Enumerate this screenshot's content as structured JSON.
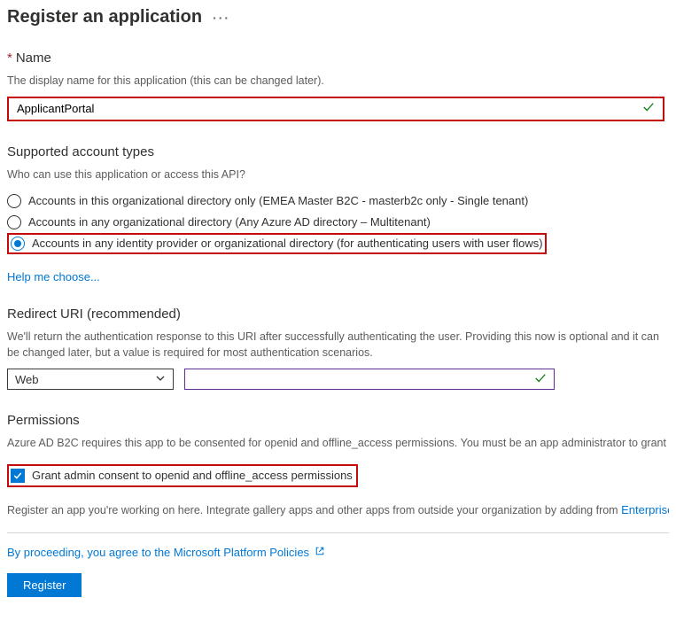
{
  "page": {
    "title": "Register an application",
    "ellipsis": "···"
  },
  "name": {
    "label": "Name",
    "description": "The display name for this application (this can be changed later).",
    "value": "ApplicantPortal"
  },
  "accountTypes": {
    "title": "Supported account types",
    "question": "Who can use this application or access this API?",
    "options": [
      "Accounts in this organizational directory only (EMEA Master B2C - masterb2c only - Single tenant)",
      "Accounts in any organizational directory (Any Azure AD directory – Multitenant)",
      "Accounts in any identity provider or organizational directory (for authenticating users with user flows)"
    ],
    "selectedIndex": 2,
    "helpLink": "Help me choose..."
  },
  "redirect": {
    "title": "Redirect URI (recommended)",
    "description": "We'll return the authentication response to this URI after successfully authenticating the user. Providing this now is optional and it can be changed later, but a value is required for most authentication scenarios.",
    "platform": "Web",
    "uri": ""
  },
  "permissions": {
    "title": "Permissions",
    "description": "Azure AD B2C requires this app to be consented for openid and offline_access permissions. You must be an app administrator to grant admin consent.",
    "checkboxLabel": "Grant admin consent to openid and offline_access permissions"
  },
  "footer": {
    "registerText": "Register an app you're working on here. Integrate gallery apps and other apps from outside your organization by adding from ",
    "enterpriseLink": "Enterprise applications",
    "policyText": "By proceeding, you agree to the Microsoft Platform Policies",
    "buttonLabel": "Register"
  },
  "asterisk": "*"
}
